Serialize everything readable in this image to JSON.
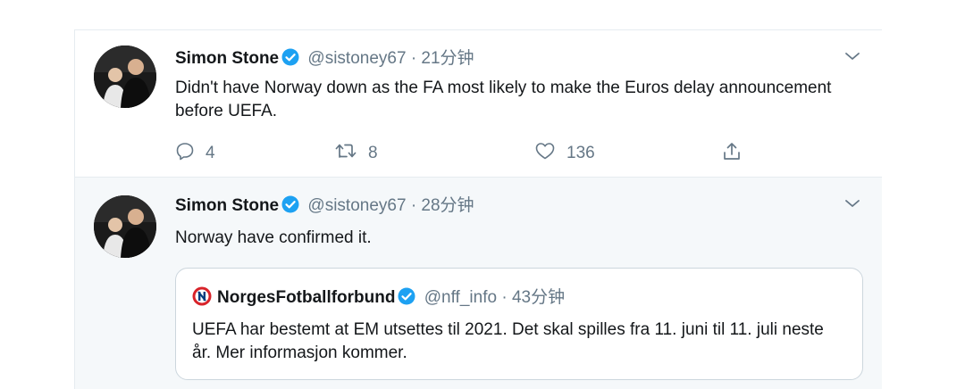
{
  "tweets": [
    {
      "name": "Simon Stone",
      "handle": "@sistoney67",
      "separator": "·",
      "time": "21分钟",
      "text": "Didn't have Norway down as the FA most likely to make the Euros delay announcement before UEFA.",
      "replies": "4",
      "retweets": "8",
      "likes": "136"
    },
    {
      "name": "Simon Stone",
      "handle": "@sistoney67",
      "separator": "·",
      "time": "28分钟",
      "text": "Norway have confirmed it.",
      "quote": {
        "name": "NorgesFotballforbund",
        "handle": "@nff_info",
        "separator": "·",
        "time": "43分钟",
        "text": "UEFA har bestemt at EM utsettes til 2021. Det skal spilles fra 11. juni til 11. juli neste år. Mer informasjon kommer."
      }
    }
  ],
  "icons": {
    "verified": "verified-badge-icon",
    "caret": "chevron-down-icon",
    "reply": "reply-icon",
    "retweet": "retweet-icon",
    "like": "heart-icon",
    "share": "share-icon",
    "nff_logo": "nff-logo-icon"
  },
  "colors": {
    "verified": "#1da1f2",
    "muted": "#657786",
    "border": "#e6ecf0",
    "highlight_bg": "#f5f8fa",
    "nff_red": "#d8232a",
    "nff_blue": "#003c7d"
  }
}
